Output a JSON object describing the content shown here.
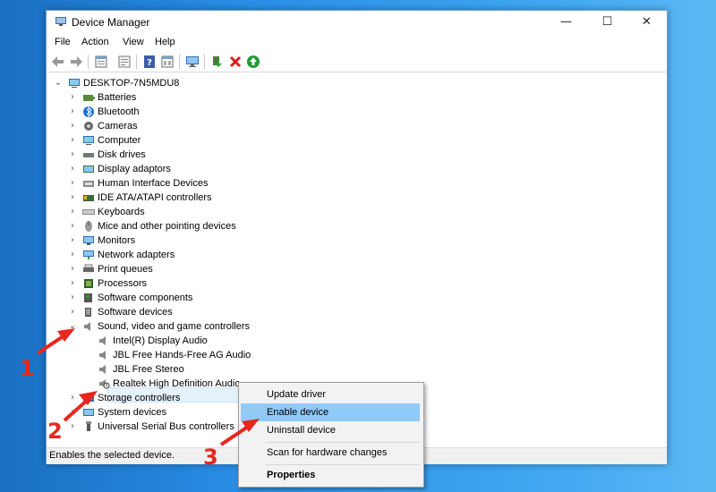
{
  "window": {
    "title": "Device Manager",
    "minimize": "—",
    "maximize": "☐",
    "close": "✕"
  },
  "menu": [
    "File",
    "Action",
    "View",
    "Help"
  ],
  "toolbar": [
    {
      "icon": "back-arrow-icon"
    },
    {
      "icon": "forward-arrow-icon"
    },
    {
      "icon": "properties-icon"
    },
    {
      "icon": "update-icon"
    },
    {
      "icon": "help-icon"
    },
    {
      "icon": "view-icon"
    },
    {
      "icon": "monitor-icon"
    },
    {
      "icon": "update-driver-icon"
    },
    {
      "icon": "uninstall-icon"
    },
    {
      "icon": "enable-icon"
    }
  ],
  "tree": {
    "root": "DESKTOP-7N5MDU8",
    "categories": [
      "Batteries",
      "Bluetooth",
      "Cameras",
      "Computer",
      "Disk drives",
      "Display adaptors",
      "Human Interface Devices",
      "IDE ATA/ATAPI controllers",
      "Keyboards",
      "Mice and other pointing devices",
      "Monitors",
      "Network adapters",
      "Print queues",
      "Processors",
      "Software components",
      "Software devices",
      "Sound, video and game controllers"
    ],
    "sound_children": [
      "Intel(R) Display Audio",
      "JBL Free Hands-Free AG Audio",
      "JBL Free Stereo",
      "Realtek High Definition Audio"
    ],
    "after": [
      "Storage controllers",
      "System devices",
      "Universal Serial Bus controllers"
    ]
  },
  "status": "Enables the selected device.",
  "context_menu": {
    "items": [
      "Update driver",
      "Enable device",
      "Uninstall device",
      "Scan for hardware changes",
      "Properties"
    ]
  },
  "annotations": [
    "1",
    "2",
    "3"
  ],
  "colors": {
    "accent": "#0078d7",
    "highlight": "#91c9f7",
    "arrow": "#e8261d",
    "desktop": "#2a8fe6"
  }
}
